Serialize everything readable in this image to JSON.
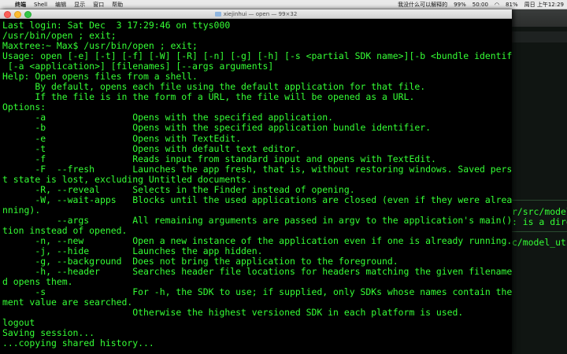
{
  "menubar": {
    "apple_icon": "",
    "items": [
      "终端",
      "Shell",
      "编辑",
      "显示",
      "窗口",
      "帮助"
    ],
    "status": [
      {
        "name": "badge",
        "text": "我没什么可以解释的"
      },
      {
        "name": "battery-pct",
        "text": "99%"
      },
      {
        "name": "download-rate",
        "text": "50:00"
      },
      {
        "name": "wifi",
        "text": "◠"
      },
      {
        "name": "battery",
        "text": "81%"
      },
      {
        "name": "clock",
        "text": "周日 上午12:29"
      }
    ]
  },
  "window": {
    "title": "xiejinhui — open — 99×32"
  },
  "terminal": {
    "lines": [
      "Last login: Sat Dec  3 17:29:46 on ttys000",
      "/usr/bin/open ; exit;",
      "Maxtree:~ Max$ /usr/bin/open ; exit;",
      "Usage: open [-e] [-t] [-f] [-W] [-R] [-n] [-g] [-h] [-s <partial SDK name>][-b <bundle identifier>]",
      " [-a <application>] [filenames] [--args arguments]",
      "Help: Open opens files from a shell.",
      "      By default, opens each file using the default application for that file.",
      "      If the file is in the form of a URL, the file will be opened as a URL.",
      "Options:",
      "      -a                Opens with the specified application.",
      "      -b                Opens with the specified application bundle identifier.",
      "      -e                Opens with TextEdit.",
      "      -t                Opens with default text editor.",
      "      -f                Reads input from standard input and opens with TextEdit.",
      "      -F  --fresh       Launches the app fresh, that is, without restoring windows. Saved persisten",
      "t state is lost, excluding Untitled documents.",
      "      -R, --reveal      Selects in the Finder instead of opening.",
      "      -W, --wait-apps   Blocks until the used applications are closed (even if they were already ru",
      "nning).",
      "          --args        All remaining arguments are passed in argv to the application's main() func",
      "tion instead of opened.",
      "      -n, --new         Open a new instance of the application even if one is already running.",
      "      -j, --hide        Launches the app hidden.",
      "      -g, --background  Does not bring the application to the foreground.",
      "      -h, --header      Searches header file locations for headers matching the given filenames, an",
      "d opens them.",
      "      -s                For -h, the SDK to use; if supplied, only SDKs whose names contain the argu",
      "ment value are searched.",
      "                        Otherwise the highest versioned SDK in each platform is used.",
      "logout",
      "Saving session...",
      "...copying shared history..."
    ]
  },
  "background_window": {
    "lines": [
      "r/src/model",
      ": is a dire",
      "c/model_util"
    ]
  }
}
